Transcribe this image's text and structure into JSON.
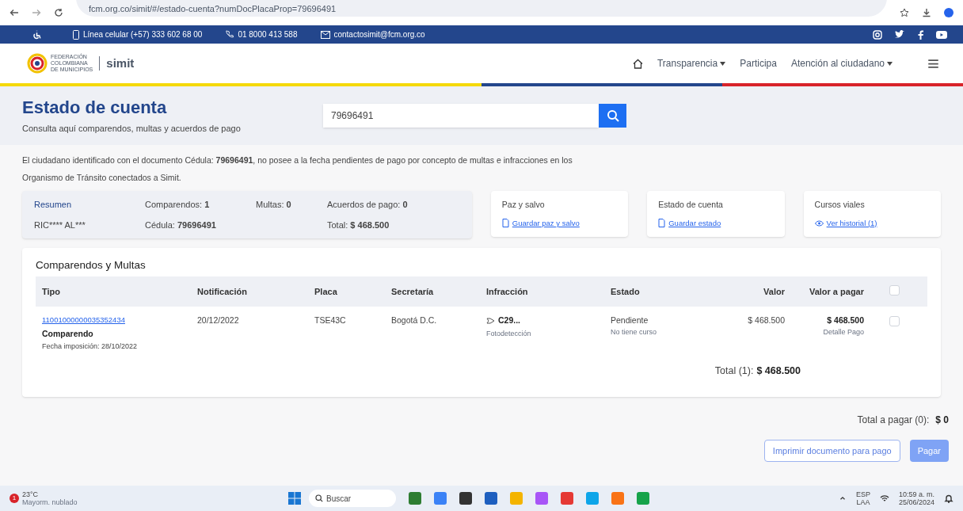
{
  "browser": {
    "url": "fcm.org.co/simit/#/estado-cuenta?numDocPlacaProp=79696491"
  },
  "contact_bar": {
    "items": [
      {
        "kind": "mobile",
        "text": "Línea celular (+57) 333 602 68 00"
      },
      {
        "kind": "phone",
        "text": "01 8000 413 588"
      },
      {
        "kind": "mail",
        "text": "contactosimit@fcm.org.co"
      }
    ]
  },
  "logo": {
    "org_lines": [
      "FEDERACIÓN",
      "COLOMBIANA",
      "DE MUNICIPIOS"
    ],
    "brand": "simit"
  },
  "nav": [
    {
      "label": "Transparencia",
      "dropdown": true
    },
    {
      "label": "Participa",
      "dropdown": false
    },
    {
      "label": "Atención al ciudadano",
      "dropdown": true
    }
  ],
  "header": {
    "title": "Estado de cuenta",
    "subtitle": "Consulta aquí comparendos, multas y acuerdos de pago",
    "search_value": "79696491"
  },
  "message": "El ciudadano identificado con el documento Cédula: **79696491**, no posee a la fecha pendientes de pago por concepto de multas e infracciones en los Organismo de Tránsito conectados a Simit.",
  "summary": {
    "title": "Resumen",
    "name": "RIC**** AL***",
    "fields": [
      "Comparendos: **1**",
      "Multas: **0**",
      "Acuerdos de pago: **0**",
      "Cédula: **79696491**",
      "Total: **$ 468.500**"
    ]
  },
  "cards": [
    {
      "title": "Paz y salvo",
      "link": "Guardar paz y salvo",
      "kind": "file"
    },
    {
      "title": "Estado de cuenta",
      "link": "Guardar estado",
      "kind": "file"
    },
    {
      "title": "Cursos viales",
      "link": "Ver historial (1)",
      "kind": "eye"
    }
  ],
  "table": {
    "title": "Comparendos y Multas",
    "columns": [
      "Tipo",
      "Notificación",
      "Placa",
      "Secretaría",
      "Infracción",
      "Estado",
      "Valor",
      "Valor a pagar"
    ],
    "select_all_checked": false,
    "rows": [
      {
        "number": "11001000000035352434",
        "type": "Comparendo",
        "imposition": "Fecha imposición: 28/10/2022",
        "notification": "20/12/2022",
        "plate": "TSE43C",
        "office": "Bogotá D.C.",
        "infraction": "C29...",
        "infraction_source": "Fotodetección",
        "status": "Pendiente",
        "course": "No tiene curso",
        "value": "$ 468.500",
        "to_pay": "$ 468.500",
        "detail": "Detalle Pago",
        "checked": false
      }
    ],
    "total_label": "Total (1):",
    "total_value": "$ 468.500"
  },
  "payment": {
    "total_label": "Total a pagar (0):",
    "total_value": "$ 0",
    "print_button": "Imprimir documento para pago",
    "pay_button": "Pagar"
  },
  "taskbar": {
    "badge": "1",
    "temperature": "23°C",
    "weather": "Mayorm. nublado",
    "search": "Buscar",
    "lang": "ESP",
    "layout": "LAA",
    "time": "10:59 a. m.",
    "date": "25/06/2024"
  }
}
